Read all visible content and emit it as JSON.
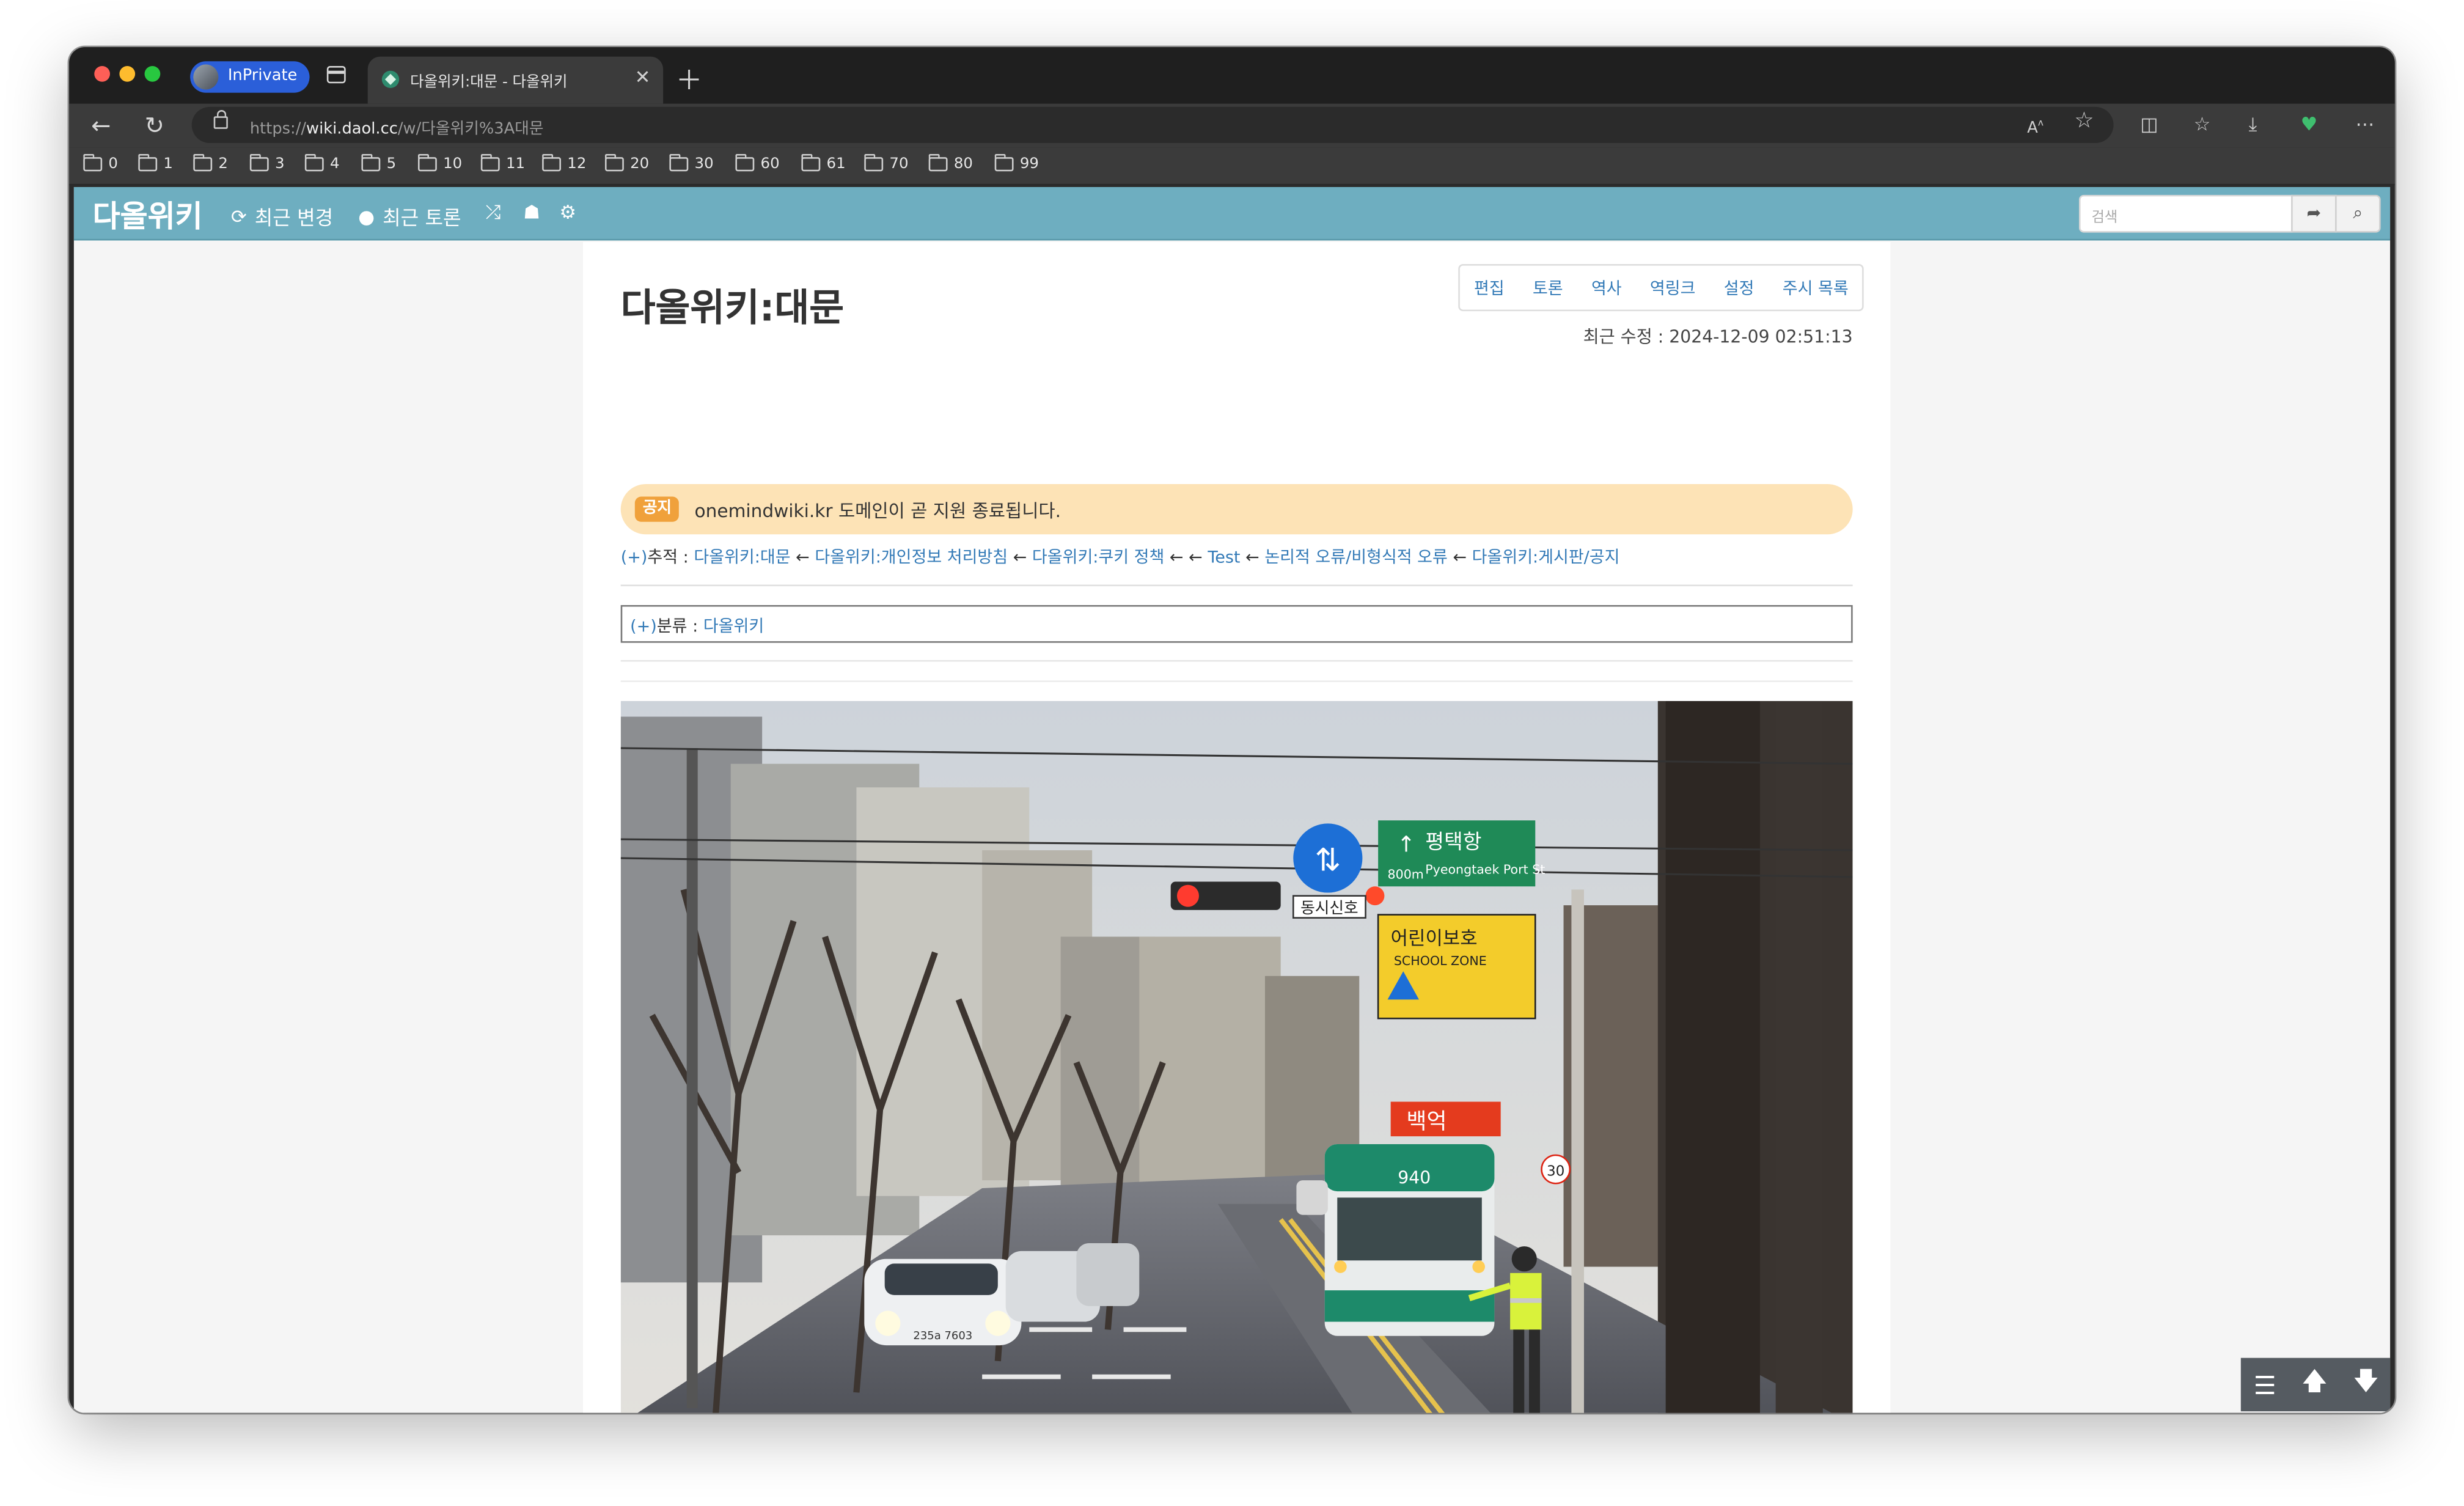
{
  "browser": {
    "profile_label": "InPrivate",
    "tab_title": "다올위키:대문 - 다올위키",
    "url_prefix": "https://",
    "url_host": "wiki.daol.cc",
    "url_path": "/w/다올위키%3A대문",
    "bookmarks": [
      "0",
      "1",
      "2",
      "3",
      "4",
      "5",
      "10",
      "11",
      "12",
      "20",
      "30",
      "60",
      "61",
      "70",
      "80",
      "99"
    ]
  },
  "site": {
    "brand": "다올위키",
    "nav": {
      "recent_changes": "최근 변경",
      "recent_discussions": "최근 토론"
    },
    "search_placeholder": "검색"
  },
  "article": {
    "title": "다올위키:대문",
    "actions": [
      "편집",
      "토론",
      "역사",
      "역링크",
      "설정",
      "주시 목록"
    ],
    "last_modified": "최근 수정 : 2024-12-09 02:51:13",
    "notice_badge": "공지",
    "notice_text": "onemindwiki.kr 도메인이 곧 지원 종료됩니다.",
    "trace_prefix": "(+)",
    "trace_label": "추적 : ",
    "trace_items": [
      "다올위키:대문",
      "다올위키:개인정보 처리방침",
      "다올위키:쿠키 정책",
      "",
      "Test",
      "논리적 오류/비형식적 오류",
      "다올위키:게시판/공지"
    ],
    "category_prefix": "(+)",
    "category_label": "분류 : ",
    "category_value": "다올위키",
    "image_text": {
      "sign_school": "어린이보호",
      "sign_school_en": "SCHOOL ZONE",
      "sign_signal": "동시신호",
      "sign_direction": "평택항",
      "sign_distance": "800m",
      "sign_dir_en": "Pyeongtaek Port St",
      "store_sign": "백억",
      "bus_number": "940",
      "speed": "30",
      "car_plate": "235a 7603"
    }
  }
}
